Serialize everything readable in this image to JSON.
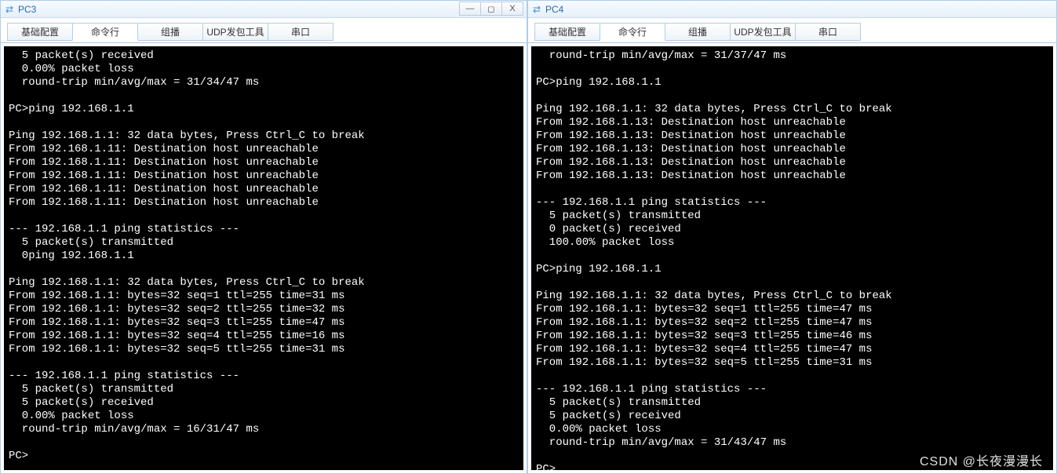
{
  "watermark": "CSDN @长夜漫漫长",
  "left": {
    "title": "PC3",
    "controls": {
      "min": "—",
      "max": "◻",
      "close": "X"
    },
    "tabs": [
      "基础配置",
      "命令行",
      "组播",
      "UDP发包工具",
      "串口"
    ],
    "activeTab": 1,
    "terminal": "  5 packet(s) received\n  0.00% packet loss\n  round-trip min/avg/max = 31/34/47 ms\n\nPC>ping 192.168.1.1\n\nPing 192.168.1.1: 32 data bytes, Press Ctrl_C to break\nFrom 192.168.1.11: Destination host unreachable\nFrom 192.168.1.11: Destination host unreachable\nFrom 192.168.1.11: Destination host unreachable\nFrom 192.168.1.11: Destination host unreachable\nFrom 192.168.1.11: Destination host unreachable\n\n--- 192.168.1.1 ping statistics ---\n  5 packet(s) transmitted\n  0ping 192.168.1.1\n\nPing 192.168.1.1: 32 data bytes, Press Ctrl_C to break\nFrom 192.168.1.1: bytes=32 seq=1 ttl=255 time=31 ms\nFrom 192.168.1.1: bytes=32 seq=2 ttl=255 time=32 ms\nFrom 192.168.1.1: bytes=32 seq=3 ttl=255 time=47 ms\nFrom 192.168.1.1: bytes=32 seq=4 ttl=255 time=16 ms\nFrom 192.168.1.1: bytes=32 seq=5 ttl=255 time=31 ms\n\n--- 192.168.1.1 ping statistics ---\n  5 packet(s) transmitted\n  5 packet(s) received\n  0.00% packet loss\n  round-trip min/avg/max = 16/31/47 ms\n\nPC>"
  },
  "right": {
    "title": "PC4",
    "tabs": [
      "基础配置",
      "命令行",
      "组播",
      "UDP发包工具",
      "串口"
    ],
    "activeTab": 1,
    "terminal": "  round-trip min/avg/max = 31/37/47 ms\n\nPC>ping 192.168.1.1\n\nPing 192.168.1.1: 32 data bytes, Press Ctrl_C to break\nFrom 192.168.1.13: Destination host unreachable\nFrom 192.168.1.13: Destination host unreachable\nFrom 192.168.1.13: Destination host unreachable\nFrom 192.168.1.13: Destination host unreachable\nFrom 192.168.1.13: Destination host unreachable\n\n--- 192.168.1.1 ping statistics ---\n  5 packet(s) transmitted\n  0 packet(s) received\n  100.00% packet loss\n\nPC>ping 192.168.1.1\n\nPing 192.168.1.1: 32 data bytes, Press Ctrl_C to break\nFrom 192.168.1.1: bytes=32 seq=1 ttl=255 time=47 ms\nFrom 192.168.1.1: bytes=32 seq=2 ttl=255 time=47 ms\nFrom 192.168.1.1: bytes=32 seq=3 ttl=255 time=46 ms\nFrom 192.168.1.1: bytes=32 seq=4 ttl=255 time=47 ms\nFrom 192.168.1.1: bytes=32 seq=5 ttl=255 time=31 ms\n\n--- 192.168.1.1 ping statistics ---\n  5 packet(s) transmitted\n  5 packet(s) received\n  0.00% packet loss\n  round-trip min/avg/max = 31/43/47 ms\n\nPC>"
  }
}
